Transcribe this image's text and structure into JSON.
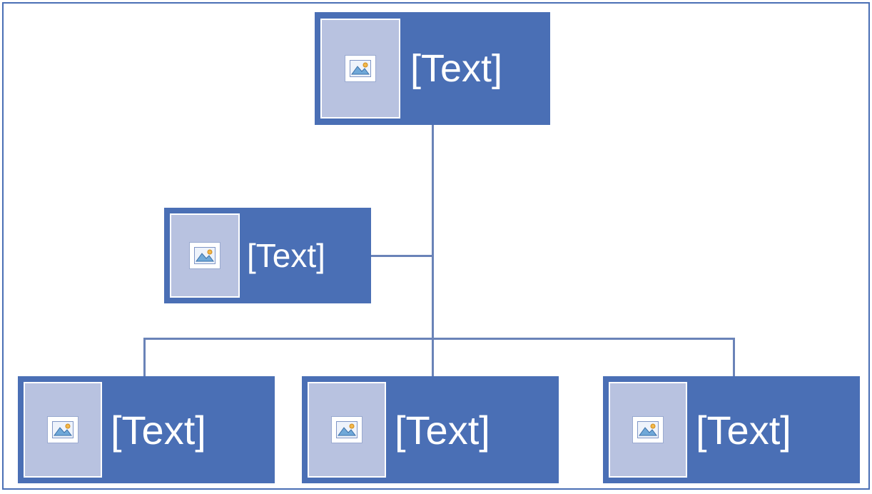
{
  "diagram": {
    "nodes": {
      "top": {
        "label": "[Text]",
        "icon": "picture-icon"
      },
      "assistant": {
        "label": "[Text]",
        "icon": "picture-icon"
      },
      "child1": {
        "label": "[Text]",
        "icon": "picture-icon"
      },
      "child2": {
        "label": "[Text]",
        "icon": "picture-icon"
      },
      "child3": {
        "label": "[Text]",
        "icon": "picture-icon"
      }
    }
  }
}
